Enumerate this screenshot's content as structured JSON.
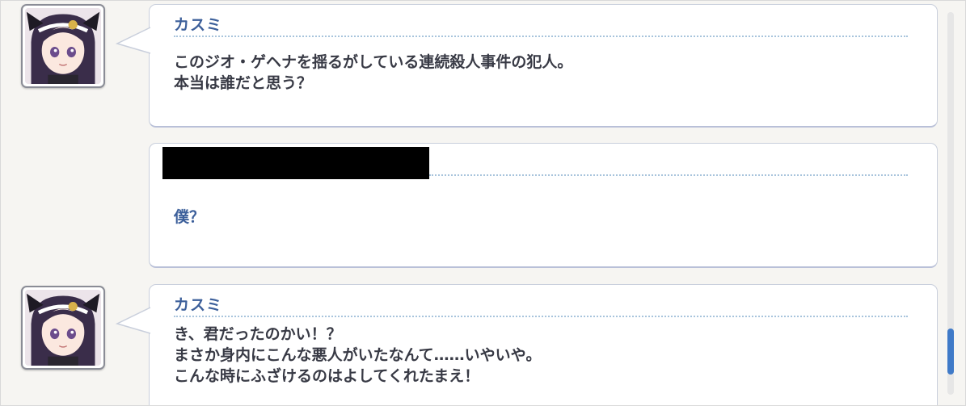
{
  "entries": [
    {
      "speaker": "カスミ",
      "lines": "このジオ・ゲヘナを揺るがしている連続殺人事件の犯人。\n本当は誰だと思う？",
      "avatar_icon": "kasumi-portrait-icon"
    },
    {
      "speaker": "",
      "lines": "僕？",
      "redacted": true
    },
    {
      "speaker": "カスミ",
      "lines": "き、君だったのかい！？\nまさか身内にこんな悪人がいたなんて……いやいや。\nこんな時にふざけるのはよしてくれたまえ！",
      "avatar_icon": "kasumi-portrait-icon"
    }
  ],
  "scroll": {
    "position": 0.94,
    "visible_fraction": 0.12
  },
  "colors": {
    "speaker": "#3c5f9a",
    "text": "#383a45",
    "scroll_thumb": "#3f7ac8",
    "divider": "#a8c4dc"
  }
}
